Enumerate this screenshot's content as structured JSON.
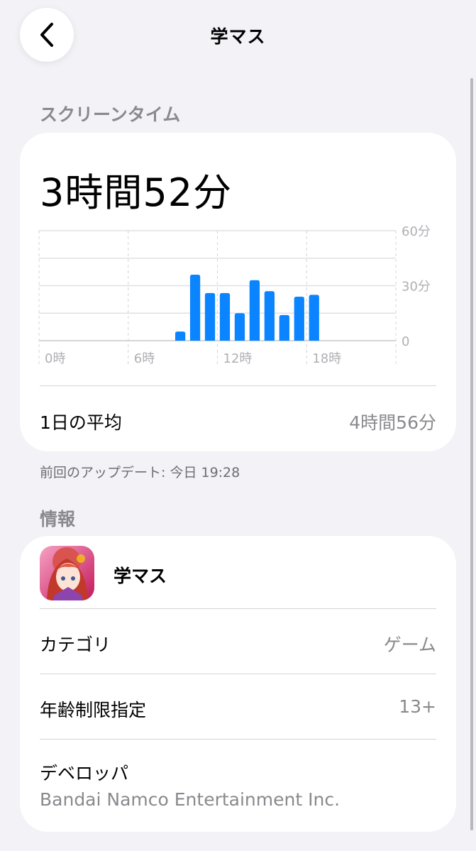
{
  "nav": {
    "title": "学マス",
    "back_icon": "chevron-left-icon"
  },
  "screen_time": {
    "section_title": "スクリーンタイム",
    "total": "3時間52分",
    "average_label": "1日の平均",
    "average_value": "4時間56分",
    "last_update": "前回のアップデート: 今日 19:28"
  },
  "chart_data": {
    "type": "bar",
    "x": [
      9,
      10,
      11,
      12,
      13,
      14,
      15,
      16,
      17,
      18
    ],
    "values": [
      5,
      36,
      26,
      26,
      15,
      33,
      27,
      14,
      24,
      25
    ],
    "x_ticks": [
      "0時",
      "6時",
      "12時",
      "18時"
    ],
    "y_ticks": [
      "60分",
      "30分",
      "0"
    ],
    "ylim": [
      0,
      60
    ],
    "xlim": [
      0,
      24
    ],
    "color": "#0a84ff",
    "grid": true
  },
  "info": {
    "section_title": "情報",
    "app_name": "学マス",
    "category_label": "カテゴリ",
    "category_value": "ゲーム",
    "age_label": "年齢制限指定",
    "age_value": "13+",
    "developer_label": "デベロッパ",
    "developer_value": "Bandai Namco Entertainment Inc."
  }
}
